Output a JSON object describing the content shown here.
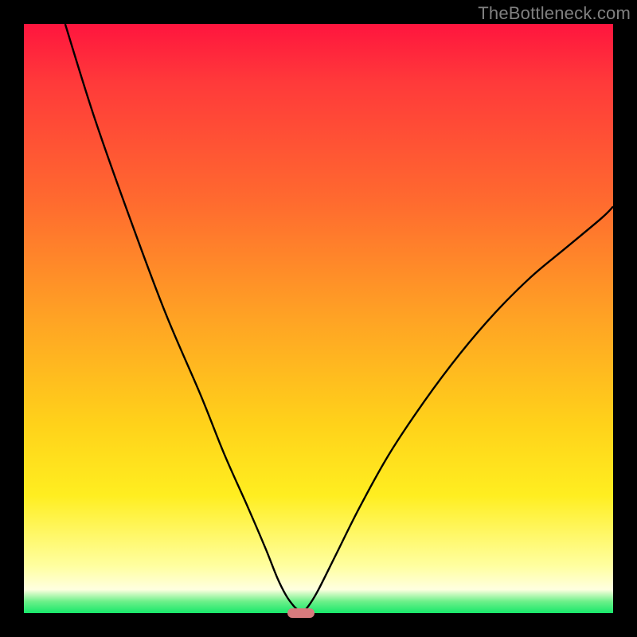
{
  "watermark": "TheBottleneck.com",
  "colors": {
    "frame": "#000000",
    "curve": "#000000",
    "marker": "#d77a7d",
    "gradient_top": "#ff153e",
    "gradient_bottom": "#17e86a"
  },
  "chart_data": {
    "type": "line",
    "title": "",
    "xlabel": "",
    "ylabel": "",
    "xlim": [
      0,
      100
    ],
    "ylim": [
      0,
      100
    ],
    "annotations": [
      {
        "text": "TheBottleneck.com",
        "position": "top-right"
      }
    ],
    "series": [
      {
        "name": "left-branch",
        "x": [
          7,
          12,
          18,
          24,
          30,
          34,
          38,
          41,
          43,
          44.5,
          45.8,
          46.7,
          47.3
        ],
        "y": [
          100,
          84,
          67,
          51,
          37,
          27,
          18,
          11,
          6,
          3,
          1.2,
          0.4,
          0
        ]
      },
      {
        "name": "right-branch",
        "x": [
          47.3,
          48.5,
          50,
          53,
          57,
          62,
          68,
          74,
          80,
          86,
          92,
          98,
          100
        ],
        "y": [
          0,
          1.5,
          4,
          10,
          18,
          27,
          36,
          44,
          51,
          57,
          62,
          67,
          69
        ]
      }
    ],
    "marker": {
      "x": 47,
      "y": 0,
      "shape": "rounded-bar"
    }
  }
}
